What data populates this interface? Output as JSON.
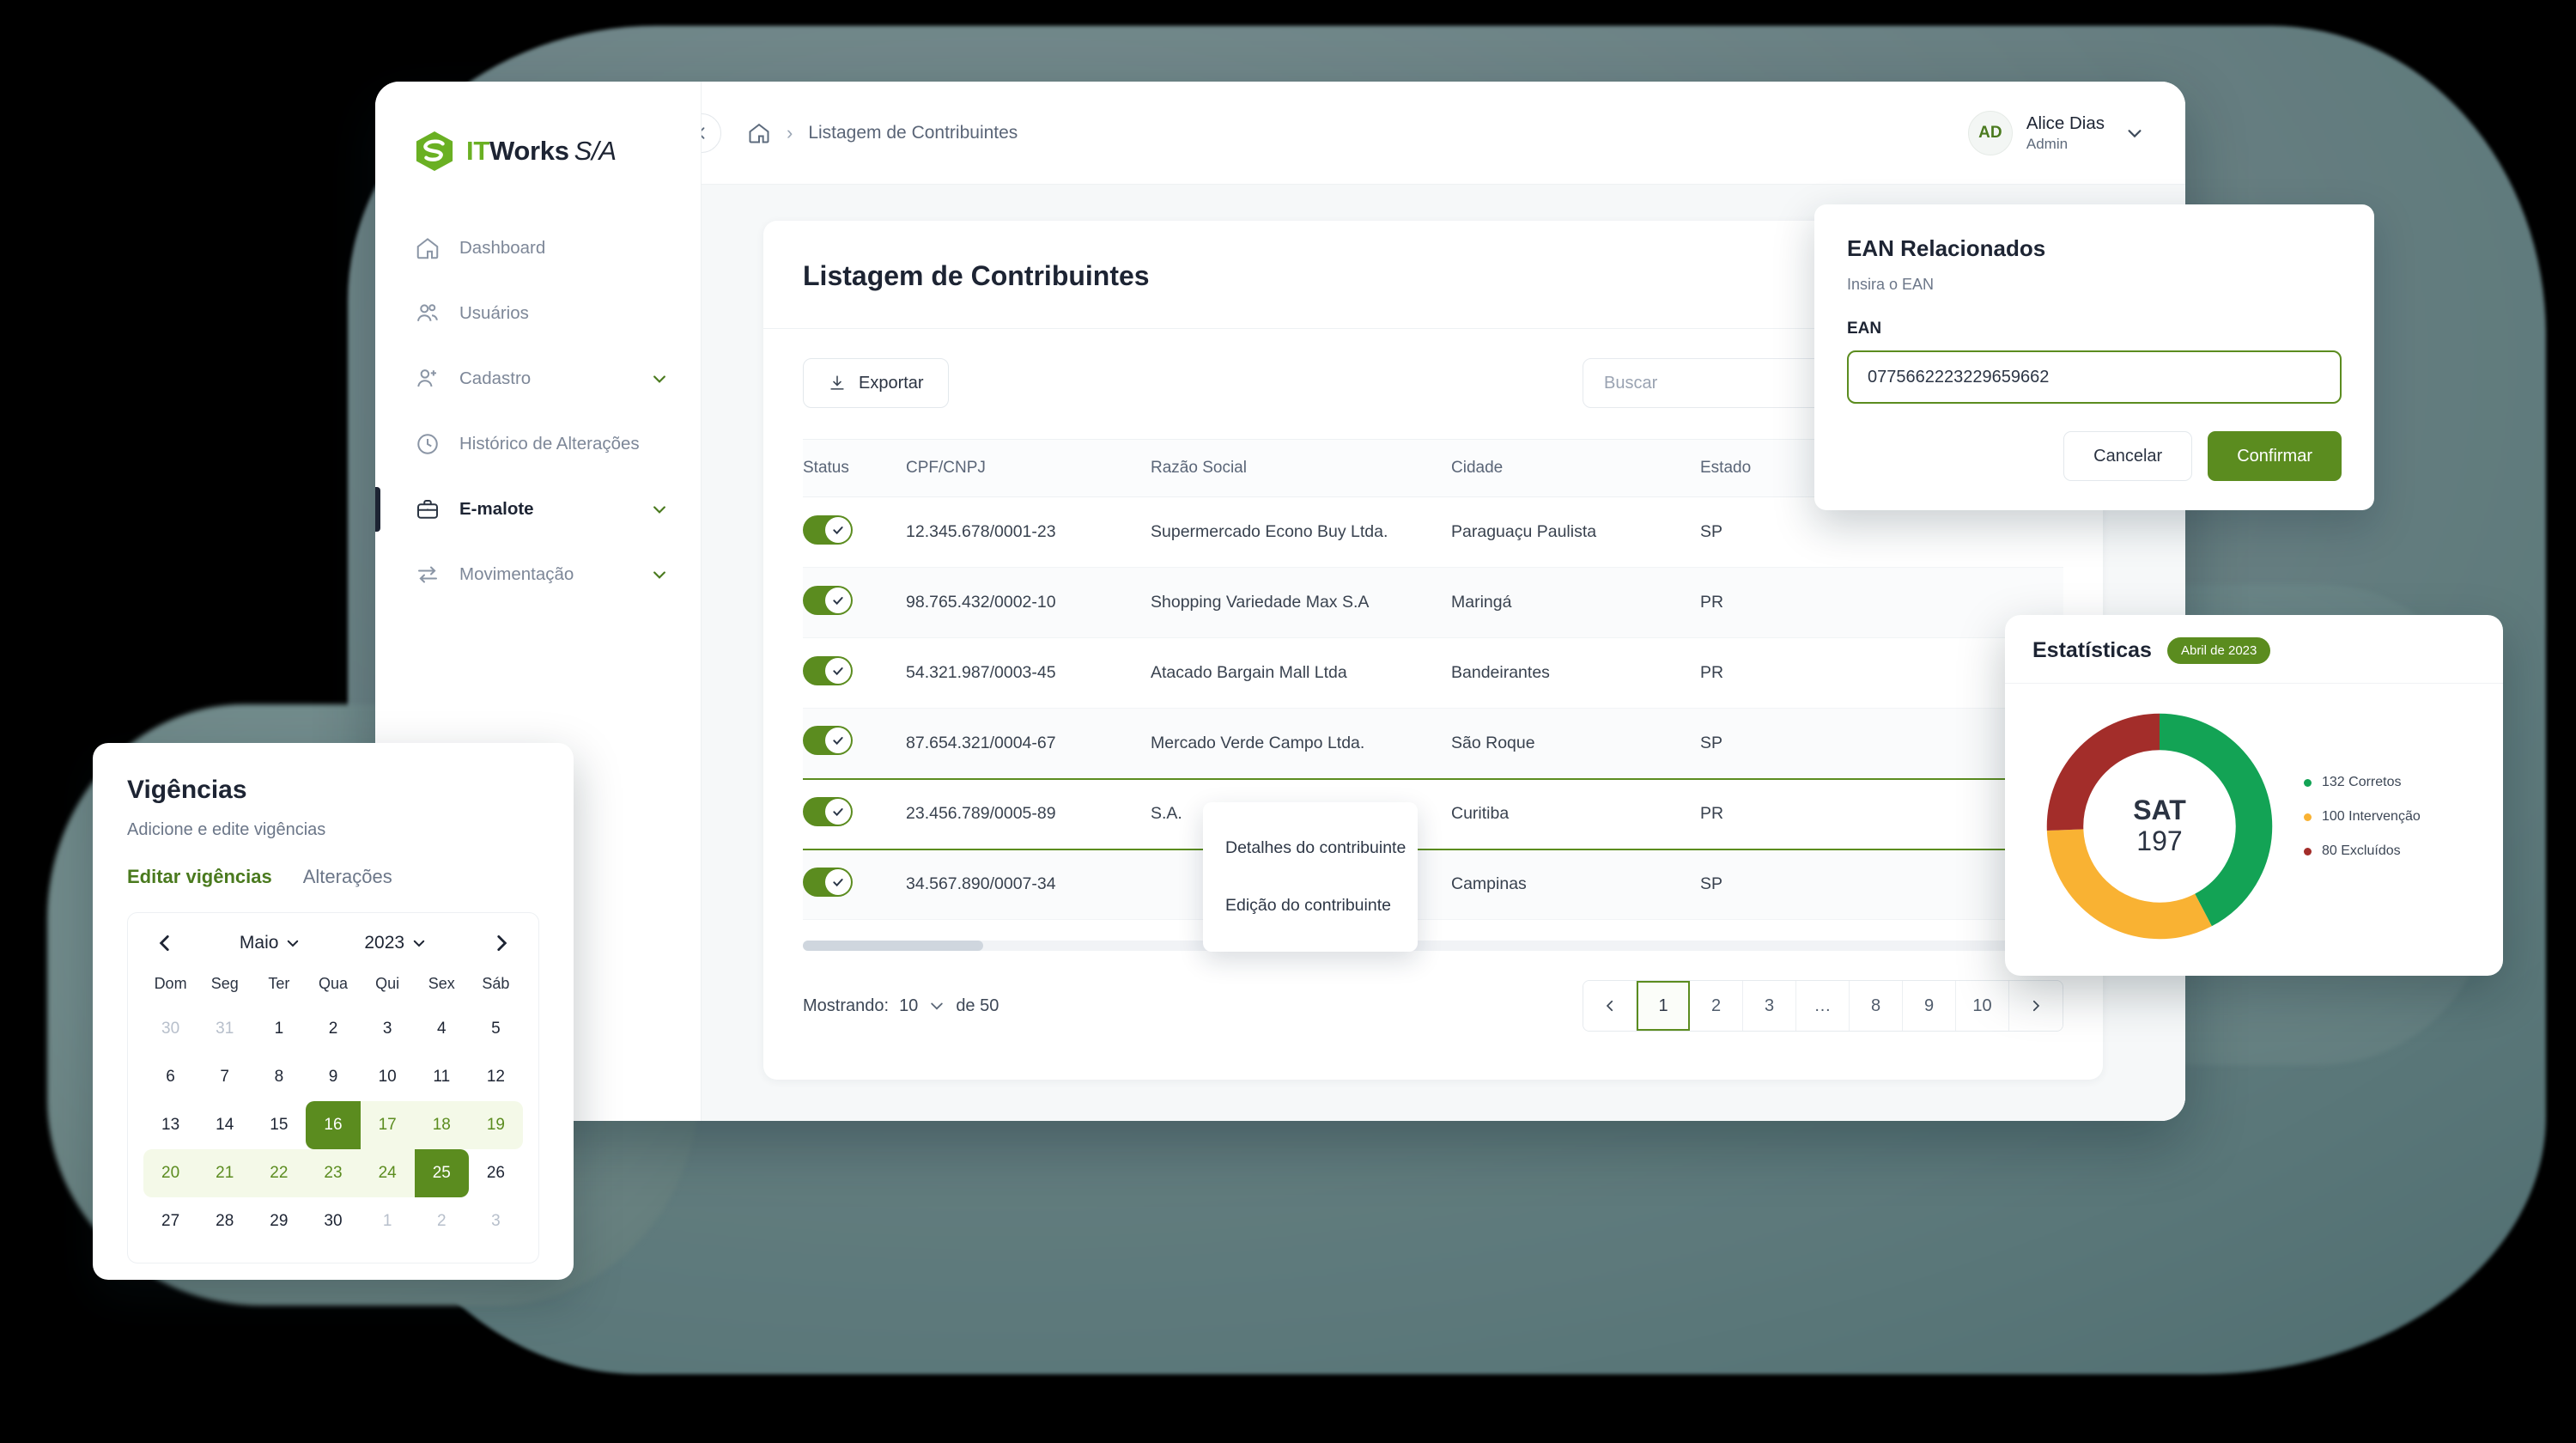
{
  "brand": {
    "it": "IT",
    "works": "Works",
    "sa": "S/A"
  },
  "sidebar": {
    "items": [
      {
        "label": "Dashboard",
        "icon": "home-icon",
        "expandable": false,
        "active": false
      },
      {
        "label": "Usuários",
        "icon": "users-icon",
        "expandable": false,
        "active": false
      },
      {
        "label": "Cadastro",
        "icon": "user-plus-icon",
        "expandable": true,
        "active": false
      },
      {
        "label": "Histórico de Alterações",
        "icon": "clock-icon",
        "expandable": false,
        "active": false
      },
      {
        "label": "E-malote",
        "icon": "briefcase-icon",
        "expandable": true,
        "active": true
      },
      {
        "label": "Movimentação",
        "icon": "transfer-icon",
        "expandable": true,
        "active": false
      }
    ]
  },
  "topbar": {
    "breadcrumb_home": "home-icon",
    "breadcrumb_separator": "›",
    "breadcrumb_current": "Listagem de Contribuintes",
    "user": {
      "initials": "AD",
      "name": "Alice Dias",
      "role": "Admin"
    }
  },
  "page": {
    "title": "Listagem de Contribuintes",
    "export_label": "Exportar",
    "search_placeholder": "Buscar",
    "search_value": ""
  },
  "table": {
    "columns": [
      "Status",
      "CPF/CNPJ",
      "Razão Social",
      "Cidade",
      "Estado"
    ],
    "rows": [
      {
        "status": true,
        "doc": "12.345.678/0001-23",
        "razao": "Supermercado Econo Buy Ltda.",
        "cidade": "Paraguaçu Paulista",
        "estado": "SP",
        "selected": false
      },
      {
        "status": true,
        "doc": "98.765.432/0002-10",
        "razao": "Shopping Variedade Max S.A",
        "cidade": "Maringá",
        "estado": "PR",
        "selected": false
      },
      {
        "status": true,
        "doc": "54.321.987/0003-45",
        "razao": "Atacado Bargain Mall Ltda",
        "cidade": "Bandeirantes",
        "estado": "PR",
        "selected": false
      },
      {
        "status": true,
        "doc": "87.654.321/0004-67",
        "razao": "Mercado Verde Campo Ltda.",
        "cidade": "São Roque",
        "estado": "SP",
        "selected": false
      },
      {
        "status": true,
        "doc": "23.456.789/0005-89",
        "razao": "S.A.",
        "cidade": "Curitiba",
        "estado": "PR",
        "selected": true
      },
      {
        "status": true,
        "doc": "34.567.890/0007-34",
        "razao": "",
        "cidade": "Campinas",
        "estado": "SP",
        "selected": false
      }
    ]
  },
  "context_menu": {
    "items": [
      "Detalhes do contribuinte",
      "Edição do contribuinte"
    ]
  },
  "footer": {
    "showing_label": "Mostrando:",
    "showing_count": "10",
    "of_label": "de 50",
    "pages": [
      "‹",
      "1",
      "2",
      "3",
      "…",
      "8",
      "9",
      "10",
      "›"
    ],
    "current_page": "1"
  },
  "ean_modal": {
    "title": "EAN Relacionados",
    "subtitle": "Insira o EAN",
    "field_label": "EAN",
    "field_value": "0775662223229659662",
    "cancel_label": "Cancelar",
    "confirm_label": "Confirmar"
  },
  "vigencias": {
    "title": "Vigências",
    "subtitle": "Adicione e edite vigências",
    "tabs": [
      "Editar vigências",
      "Alterações"
    ],
    "active_tab": "Editar vigências",
    "month": "Maio",
    "year": "2023",
    "dow": [
      "Dom",
      "Seg",
      "Ter",
      "Qua",
      "Qui",
      "Sex",
      "Sáb"
    ],
    "weeks": [
      [
        {
          "d": "30",
          "state": "muted"
        },
        {
          "d": "31",
          "state": "muted"
        },
        {
          "d": "1",
          "state": ""
        },
        {
          "d": "2",
          "state": ""
        },
        {
          "d": "3",
          "state": ""
        },
        {
          "d": "4",
          "state": ""
        },
        {
          "d": "5",
          "state": ""
        }
      ],
      [
        {
          "d": "6",
          "state": ""
        },
        {
          "d": "7",
          "state": ""
        },
        {
          "d": "8",
          "state": ""
        },
        {
          "d": "9",
          "state": ""
        },
        {
          "d": "10",
          "state": ""
        },
        {
          "d": "11",
          "state": ""
        },
        {
          "d": "12",
          "state": ""
        }
      ],
      [
        {
          "d": "13",
          "state": ""
        },
        {
          "d": "14",
          "state": ""
        },
        {
          "d": "15",
          "state": ""
        },
        {
          "d": "16",
          "state": "sel range-start"
        },
        {
          "d": "17",
          "state": "inrange"
        },
        {
          "d": "18",
          "state": "inrange"
        },
        {
          "d": "19",
          "state": "inrange edge-r"
        }
      ],
      [
        {
          "d": "20",
          "state": "inrange edge-l"
        },
        {
          "d": "21",
          "state": "inrange"
        },
        {
          "d": "22",
          "state": "inrange"
        },
        {
          "d": "23",
          "state": "inrange"
        },
        {
          "d": "24",
          "state": "inrange"
        },
        {
          "d": "25",
          "state": "sel range-end"
        },
        {
          "d": "26",
          "state": ""
        }
      ],
      [
        {
          "d": "27",
          "state": ""
        },
        {
          "d": "28",
          "state": ""
        },
        {
          "d": "29",
          "state": ""
        },
        {
          "d": "30",
          "state": ""
        },
        {
          "d": "1",
          "state": "muted"
        },
        {
          "d": "2",
          "state": "muted"
        },
        {
          "d": "3",
          "state": "muted"
        }
      ]
    ]
  },
  "stats": {
    "title": "Estatísticas",
    "badge": "Abril de 2023",
    "center_label": "SAT",
    "center_value": "197"
  },
  "chart_data": {
    "type": "pie",
    "title": "Estatísticas",
    "subtitle": "Abril de 2023",
    "center_label": "SAT",
    "center_value": 197,
    "categories": [
      "Corretos",
      "Intervenção",
      "Excluídos"
    ],
    "values": [
      132,
      100,
      80
    ],
    "labels": [
      "132 Corretos",
      "100 Intervenção",
      "80 Excluídos"
    ],
    "colors": [
      "#13a355",
      "#f9b233",
      "#a32d2a"
    ],
    "legend_position": "right",
    "donut": true
  },
  "colors": {
    "brand_green": "#6ab023",
    "accent_green": "#5b8c1f",
    "dark": "#1d2433",
    "correct": "#13a355",
    "intervention": "#f9b233",
    "excluded": "#a32d2a"
  }
}
